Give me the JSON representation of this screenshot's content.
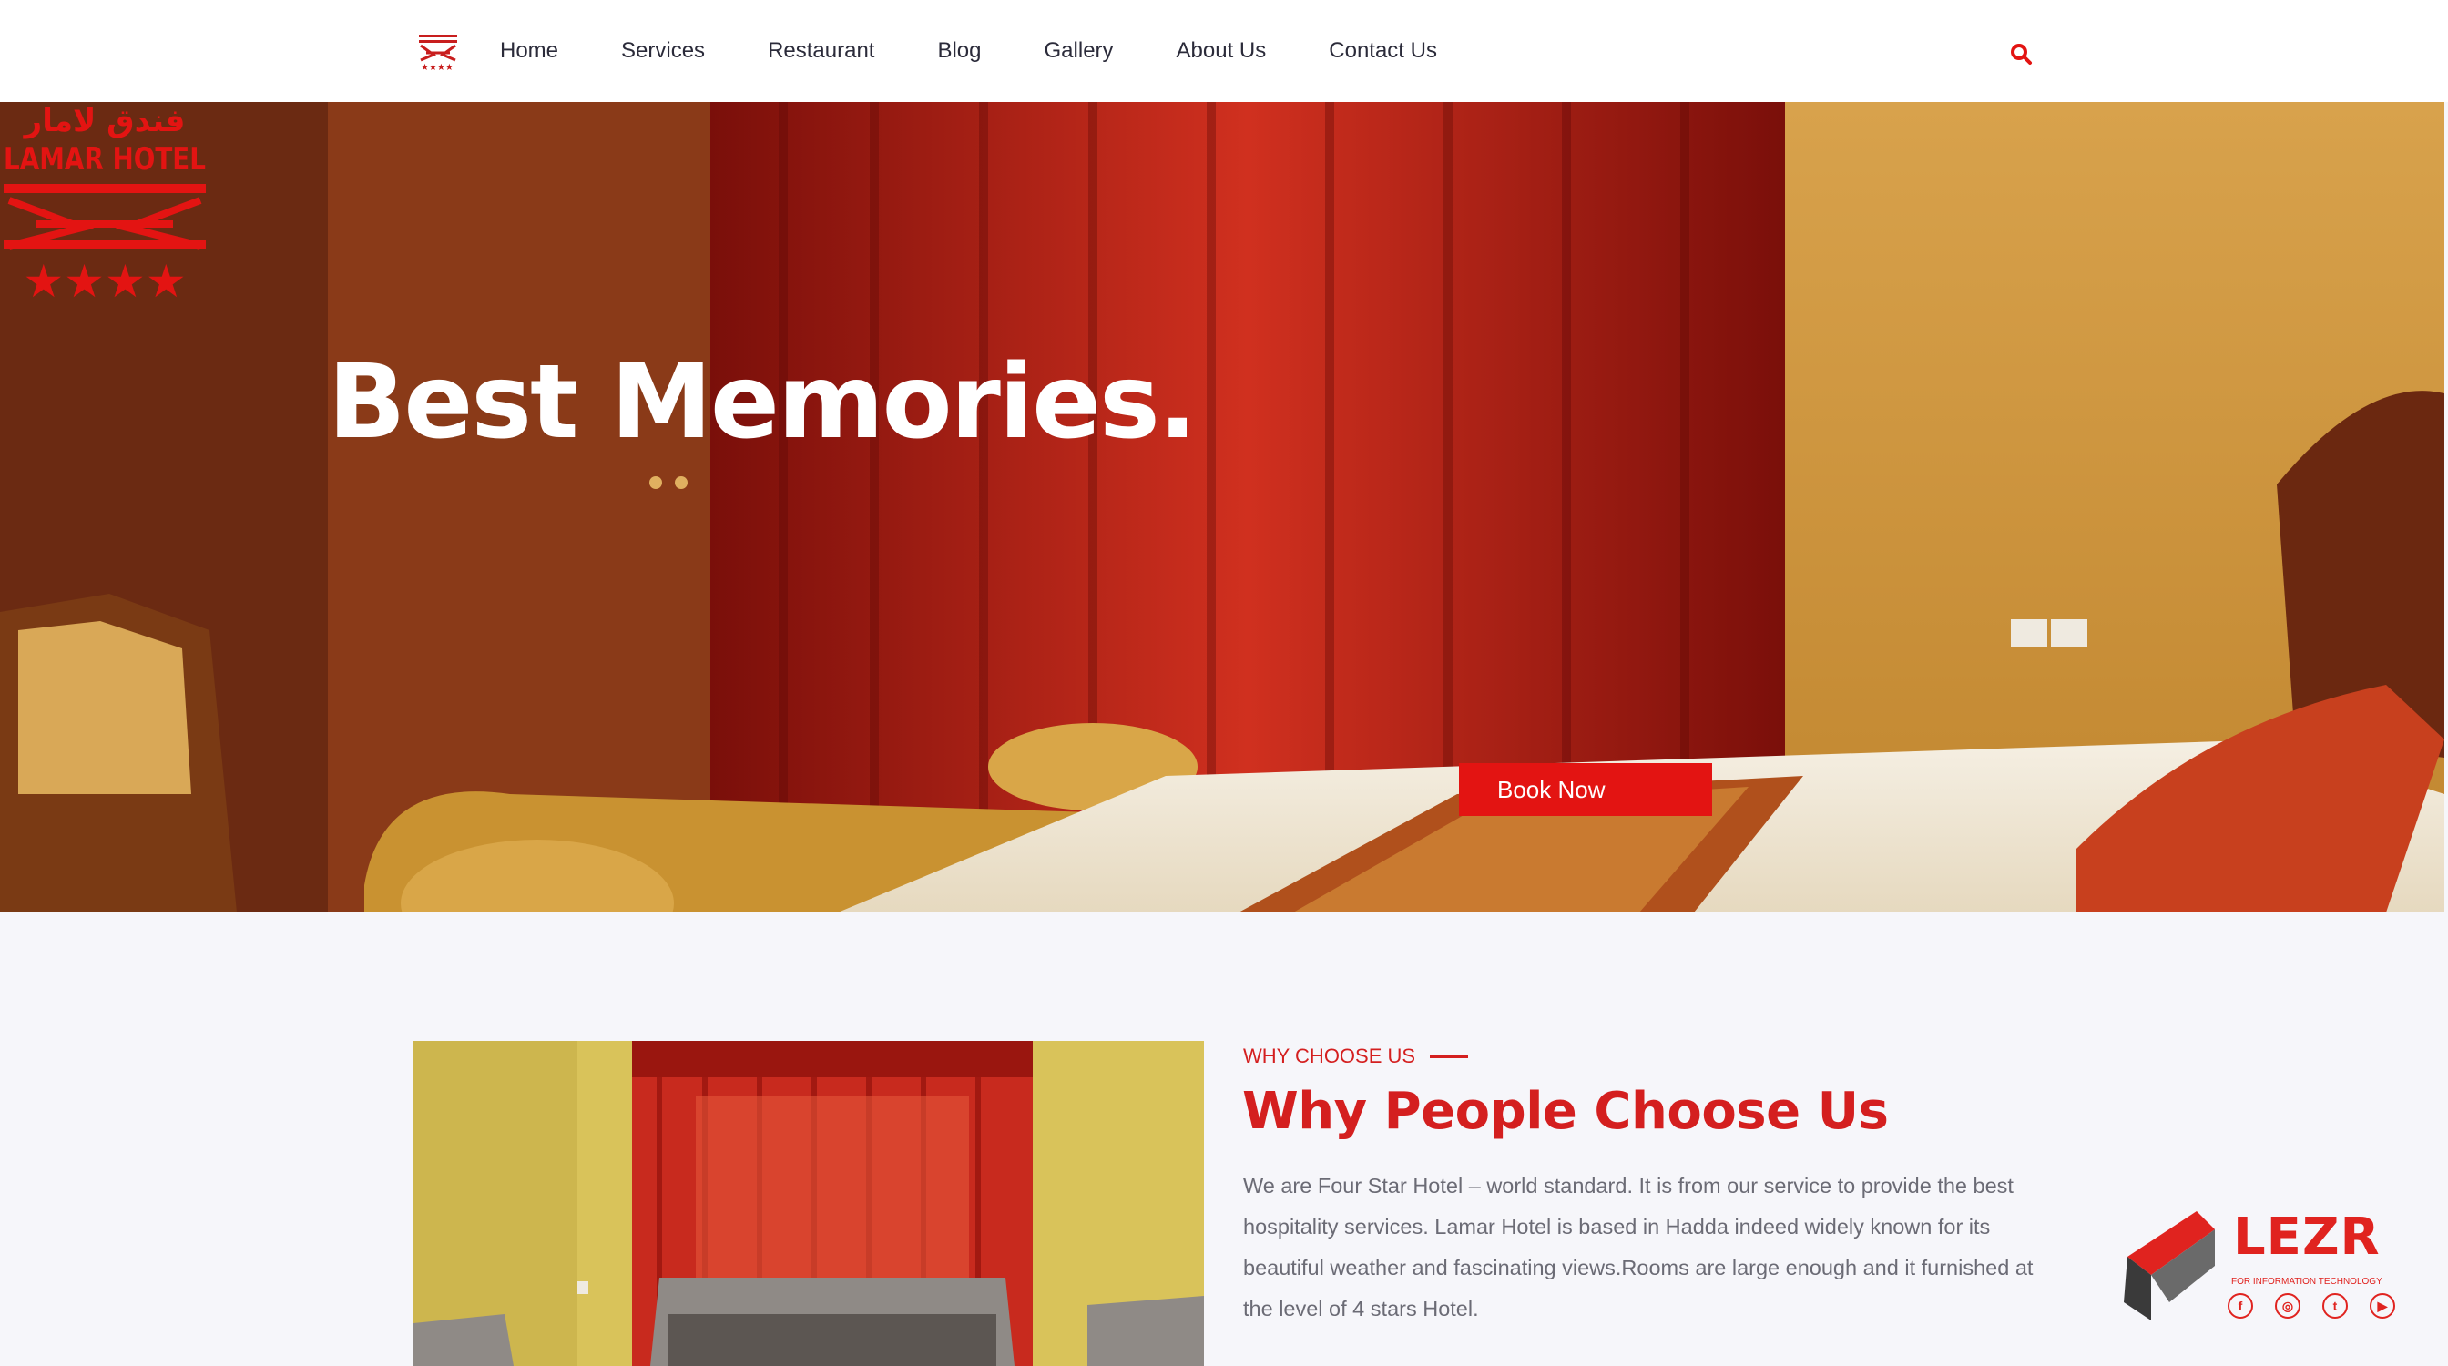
{
  "nav": {
    "items": [
      {
        "label": "Home"
      },
      {
        "label": "Services"
      },
      {
        "label": "Restaurant"
      },
      {
        "label": "Blog"
      },
      {
        "label": "Gallery"
      },
      {
        "label": "About Us"
      },
      {
        "label": "Contact Us"
      }
    ],
    "search_icon": "search-icon"
  },
  "hero": {
    "title": "Best Memories.",
    "book_button": "Book Now",
    "logo": {
      "arabic": "فندق لامار",
      "name": "LAMAR HOTEL",
      "stars": 4
    }
  },
  "about": {
    "eyebrow": "WHY CHOOSE US",
    "title": "Why People Choose Us",
    "text": "We are Four Star Hotel – world standard. It is from our service to provide the best hospitality services. Lamar Hotel is based in Hadda indeed widely known for its beautiful weather and fascinating views.Rooms are large enough and it furnished at the level of 4 stars Hotel."
  },
  "lezr": {
    "name": "LEZR",
    "tagline": "FOR INFORMATION TECHNOLOGY",
    "social": [
      "facebook-icon",
      "instagram-icon",
      "twitter-icon",
      "youtube-icon"
    ]
  },
  "colors": {
    "accent": "#e31412",
    "heading": "#d41f1f",
    "text": "#6b6b75",
    "nav_text": "#2b2b3a"
  }
}
